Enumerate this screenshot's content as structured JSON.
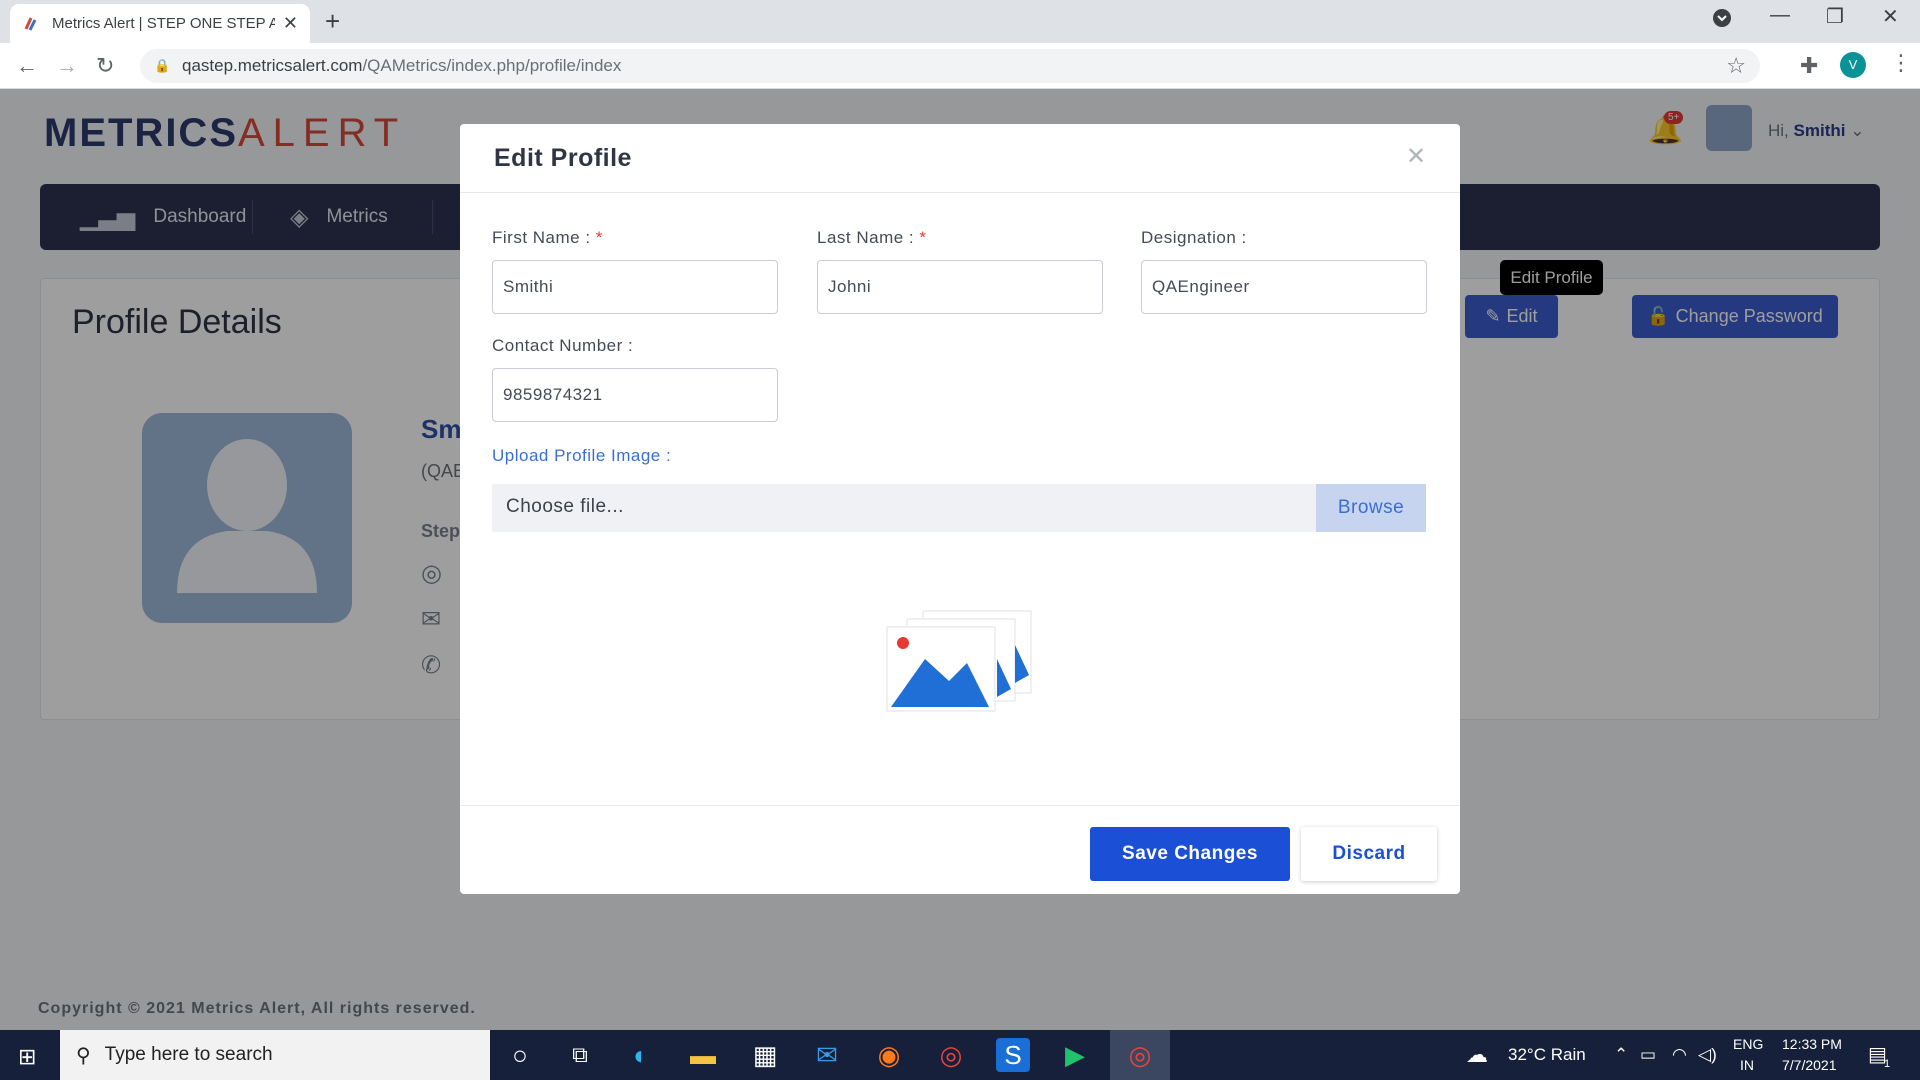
{
  "browser": {
    "tab_title": "Metrics Alert | STEP ONE STEP AH",
    "url_host": "qastep.metricsalert.com",
    "url_path": "/QAMetrics/index.php/profile/index",
    "profile_initial": "V"
  },
  "header": {
    "logo_part1": "METRICS",
    "logo_part2": "ALERT",
    "notification_badge": "5+",
    "greeting": "Hi,",
    "username": "Smithi"
  },
  "nav": {
    "items": [
      {
        "label": "Dashboard",
        "icon": "bar-chart-icon"
      },
      {
        "label": "Metrics",
        "icon": "layers-icon"
      }
    ]
  },
  "profile_card": {
    "title": "Profile Details",
    "edit_label": "Edit",
    "change_password_label": "Change Password",
    "tooltip": "Edit Profile",
    "name_partial": "Sm",
    "role_partial": "(QAE",
    "step_partial": "Step"
  },
  "modal": {
    "title": "Edit Profile",
    "first_name_label": "First Name :",
    "first_name_value": "Smithi",
    "last_name_label": "Last Name :",
    "last_name_value": "Johni",
    "designation_label": "Designation :",
    "designation_value": "QAEngineer",
    "contact_label": "Contact Number :",
    "contact_value": "9859874321",
    "upload_label": "Upload Profile Image :",
    "file_placeholder": "Choose file...",
    "browse_label": "Browse",
    "save_label": "Save Changes",
    "discard_label": "Discard",
    "required_mark": "*"
  },
  "footer": {
    "copyright": "Copyright © 2021 Metrics Alert, All rights reserved."
  },
  "taskbar": {
    "search_placeholder": "Type here to search",
    "weather": "32°C  Rain",
    "lang_top": "ENG",
    "lang_bottom": "IN",
    "time": "12:33 PM",
    "date": "7/7/2021",
    "notif_count": "1"
  },
  "colors": {
    "accent": "#3d5ccf",
    "save": "#1a4fd6",
    "navbar": "#2d3350"
  }
}
